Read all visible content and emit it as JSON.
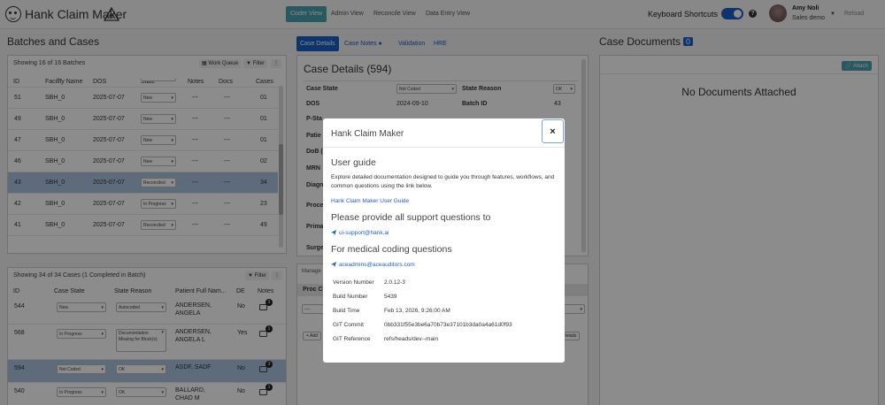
{
  "header": {
    "app_title": "Hank Claim Maker",
    "nav": [
      "Coder View",
      "Admin View",
      "Reconcile View",
      "Data Entry View"
    ],
    "keyboard_shortcuts": "Keyboard Shortcuts",
    "user_name": "Amy Noli",
    "user_role": "Sales demo",
    "reload": "Reload"
  },
  "batches": {
    "title": "Batches and Cases",
    "showing": "Showing 16 of 16 Batches",
    "work_queue": "Work Queue",
    "filter": "Filter",
    "columns": [
      "ID",
      "Facility Name",
      "DOS",
      "State",
      "Notes",
      "Docs",
      "Cases"
    ],
    "rows": [
      {
        "id": "53",
        "facility": "SBH_0",
        "dos": "2025-07-07",
        "state": "New",
        "notes": "---",
        "docs": "---",
        "cases": "05"
      },
      {
        "id": "51",
        "facility": "SBH_0",
        "dos": "2025-07-07",
        "state": "New",
        "notes": "---",
        "docs": "---",
        "cases": "01"
      },
      {
        "id": "49",
        "facility": "SBH_0",
        "dos": "2025-07-07",
        "state": "New",
        "notes": "---",
        "docs": "---",
        "cases": "01"
      },
      {
        "id": "47",
        "facility": "SBH_0",
        "dos": "2025-07-07",
        "state": "New",
        "notes": "---",
        "docs": "---",
        "cases": "01"
      },
      {
        "id": "46",
        "facility": "SBH_0",
        "dos": "2025-07-07",
        "state": "New",
        "notes": "---",
        "docs": "---",
        "cases": "02"
      },
      {
        "id": "43",
        "facility": "SBH_0",
        "dos": "2025-07-07",
        "state": "Reconciled",
        "notes": "---",
        "docs": "---",
        "cases": "34"
      },
      {
        "id": "42",
        "facility": "SBH_0",
        "dos": "2025-07-07",
        "state": "In Progress",
        "notes": "---",
        "docs": "---",
        "cases": "23"
      },
      {
        "id": "41",
        "facility": "SBH_0",
        "dos": "2025-07-07",
        "state": "Reconciled",
        "notes": "---",
        "docs": "---",
        "cases": "49"
      }
    ]
  },
  "cases": {
    "showing": "Showing 34 of 34 Cases (1 Completed in Batch)",
    "filter": "Filter",
    "columns": [
      "ID",
      "Case State",
      "State Reason",
      "Patient Full Nam...",
      "DE",
      "Notes"
    ],
    "rows": [
      {
        "id": "544",
        "state": "New",
        "reason": "Autocoded",
        "patient": "ANDERSEN, ANGELA",
        "de": "No",
        "notes": "3"
      },
      {
        "id": "568",
        "state": "In Progress",
        "reason": "Documentation Missing for Block(s)",
        "patient": "ANDERSEN, ANGELA L",
        "de": "Yes",
        "notes": "1"
      },
      {
        "id": "594",
        "state": "Not Coded",
        "reason": "OK",
        "patient": "ASDF, SADF",
        "de": "No",
        "notes": "3"
      },
      {
        "id": "540",
        "state": "In Progress",
        "reason": "OK",
        "patient": "BALLARD, CHAD M",
        "de": "No",
        "notes": "1"
      }
    ]
  },
  "details": {
    "tabs": [
      "Case Details",
      "Case Notes",
      "Validation",
      "HRE"
    ],
    "title": "Case Details (594)",
    "labels": [
      "Case State",
      "DOS",
      "P-Sta",
      "Patie",
      "DoB (",
      "MRN",
      "Diagn",
      "Proce",
      "Prima",
      "Surge"
    ],
    "case_state_value": "Not Coded",
    "state_reason_label": "State Reason",
    "state_reason_value": "OK",
    "dos_value": "2024-09-10",
    "batch_id_label": "Batch ID",
    "batch_id_value": "43",
    "lower_head": "Manage",
    "proc_label": "Proc Ci",
    "add_label": "+ Add",
    "details_label": "Details"
  },
  "documents": {
    "title": "Case Documents",
    "count": "0",
    "attach": "Attach",
    "empty": "No Documents Attached"
  },
  "modal": {
    "title": "Hank Claim Maker",
    "close": "×",
    "user_guide_heading": "User guide",
    "user_guide_text": "Explore detailed documentation designed to guide you through features, workflows, and common questions using the link below.",
    "user_guide_link": "Hank Claim Maker User Guide",
    "support_heading": "Please provide all support questions to",
    "support_email": "ui-support@hank.ai",
    "coding_heading": "For medical coding questions",
    "coding_email": "aceadmins@aceauditors.com",
    "version": [
      {
        "label": "Version Number",
        "value": "2.0.12-3"
      },
      {
        "label": "Build Number",
        "value": "5439"
      },
      {
        "label": "Build Time",
        "value": "Feb 13, 2026, 9:26:00 AM"
      },
      {
        "label": "GIT Commit",
        "value": "0bb331f55e3be6a70b73e37101b3da0a4a61d0f93"
      },
      {
        "label": "GIT Reference",
        "value": "refs/heads/dev--main"
      }
    ]
  }
}
